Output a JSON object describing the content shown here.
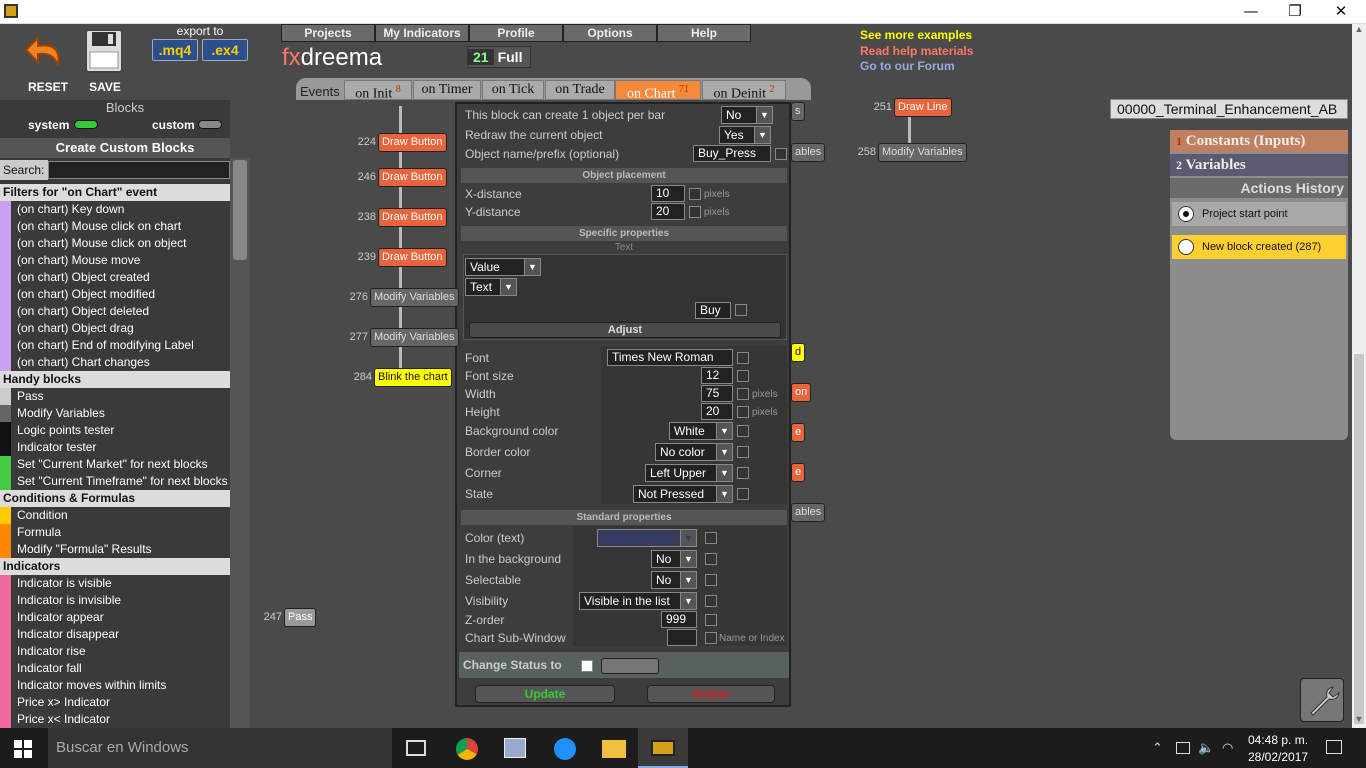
{
  "window": {
    "minimize": "—",
    "maximize": "❐",
    "close": "✕"
  },
  "toolbar": {
    "reset": "RESET",
    "save": "SAVE",
    "export_to": "export to",
    "mq4": ".mq4",
    "ex4": ".ex4"
  },
  "menu": [
    "Projects",
    "My Indicators",
    "Profile",
    "Options",
    "Help"
  ],
  "brand": {
    "fx": "fx",
    "name": "dreema",
    "count": "21",
    "plan": "Full"
  },
  "links": {
    "examples": "See more examples",
    "help": "Read help materials",
    "forum": "Go to our Forum"
  },
  "events": {
    "label": "Events",
    "tabs": [
      {
        "label": "on Init",
        "count": "8"
      },
      {
        "label": "on Timer",
        "count": ""
      },
      {
        "label": "on Tick",
        "count": ""
      },
      {
        "label": "on Trade",
        "count": ""
      },
      {
        "label": "on Chart",
        "count": "71"
      },
      {
        "label": "on Deinit",
        "count": "2"
      }
    ]
  },
  "left": {
    "blocks": "Blocks",
    "system": "system",
    "custom": "custom",
    "create": "Create Custom Blocks",
    "search_label": "Search:",
    "sections": [
      {
        "title": "Filters for \"on Chart\" event",
        "color": "#c9a0f0",
        "items": [
          "(on chart) Key down",
          "(on chart) Mouse click on chart",
          "(on chart) Mouse click on object",
          "(on chart) Mouse move",
          "(on chart) Object created",
          "(on chart) Object modified",
          "(on chart) Object deleted",
          "(on chart) Object drag",
          "(on chart) End of modifying Label",
          "(on chart) Chart changes"
        ]
      },
      {
        "title": "Handy blocks",
        "color": "",
        "items": [
          "Pass",
          "Modify Variables",
          "Logic points tester",
          "Indicator tester",
          "Set \"Current Market\" for next blocks",
          "Set \"Current Timeframe\" for next blocks"
        ]
      },
      {
        "title": "Conditions & Formulas",
        "color": "",
        "items": [
          "Condition",
          "Formula",
          "Modify \"Formula\" Results"
        ]
      },
      {
        "title": "Indicators",
        "color": "#f06aa0",
        "items": [
          "Indicator is visible",
          "Indicator is invisible",
          "Indicator appear",
          "Indicator disappear",
          "Indicator rise",
          "Indicator fall",
          "Indicator moves within limits",
          "Price x> Indicator",
          "Price x< Indicator"
        ]
      }
    ]
  },
  "nodes": [
    {
      "num": "224",
      "label": "Draw Button",
      "style": "red"
    },
    {
      "num": "246",
      "label": "Draw Button",
      "style": "red"
    },
    {
      "num": "238",
      "label": "Draw Button",
      "style": "red"
    },
    {
      "num": "239",
      "label": "Draw Button",
      "style": "red"
    },
    {
      "num": "276",
      "label": "Modify Variables",
      "style": "gray"
    },
    {
      "num": "277",
      "label": "Modify Variables",
      "style": "gray"
    },
    {
      "num": "284",
      "label": "Blink the chart",
      "style": "yel"
    },
    {
      "num": "247",
      "label": "Pass",
      "style": "pass"
    },
    {
      "num": "251",
      "label": "Draw Line",
      "style": "red"
    },
    {
      "num": "258",
      "label": "Modify Variables",
      "style": "gray"
    }
  ],
  "peek": {
    "a": "ables",
    "b": "d",
    "c": "on",
    "d": "e",
    "e": "e",
    "f": "ables",
    "g": "s"
  },
  "dialog": {
    "row1": {
      "label": "This block can create 1 object per bar",
      "value": "No"
    },
    "row2": {
      "label": "Redraw the current object",
      "value": "Yes"
    },
    "row3": {
      "label": "Object name/prefix (optional)",
      "value": "Buy_Press"
    },
    "placement": "Object placement",
    "xdist": {
      "label": "X-distance",
      "value": "10",
      "unit": "pixels"
    },
    "ydist": {
      "label": "Y-distance",
      "value": "20",
      "unit": "pixels"
    },
    "specific": "Specific properties",
    "text_hdr": "Text",
    "value_sel": "Value",
    "text_sel": "Text",
    "text_value": "Buy",
    "adjust": "Adjust",
    "font": {
      "label": "Font",
      "value": "Times New Roman"
    },
    "fontsize": {
      "label": "Font size",
      "value": "12"
    },
    "width": {
      "label": "Width",
      "value": "75",
      "unit": "pixels"
    },
    "height": {
      "label": "Height",
      "value": "20",
      "unit": "pixels"
    },
    "bgcolor": {
      "label": "Background color",
      "value": "White"
    },
    "border": {
      "label": "Border color",
      "value": "No color"
    },
    "corner": {
      "label": "Corner",
      "value": "Left Upper"
    },
    "state": {
      "label": "State",
      "value": "Not Pressed"
    },
    "standard": "Standard properties",
    "colortext": {
      "label": "Color (text)",
      "value": "MidnightBlue"
    },
    "inbg": {
      "label": "In the background",
      "value": "No"
    },
    "selectable": {
      "label": "Selectable",
      "value": "No"
    },
    "visibility": {
      "label": "Visibility",
      "value": "Visible in the list"
    },
    "zorder": {
      "label": "Z-order",
      "value": "999"
    },
    "subwin": {
      "label": "Chart Sub-Window",
      "note": "Name or Index"
    },
    "status": "Change Status to",
    "update": "Update",
    "delete": "Delete"
  },
  "right": {
    "project": "00000_Terminal_Enhancement_AB",
    "constants_num": "1",
    "constants": "Constants (Inputs)",
    "variables_num": "2",
    "variables": "Variables",
    "history": "Actions History",
    "h1": "Project start point",
    "h2": "New block created (287)"
  },
  "taskbar": {
    "search": "Buscar en Windows",
    "time": "04:48 p. m.",
    "date": "28/02/2017"
  }
}
